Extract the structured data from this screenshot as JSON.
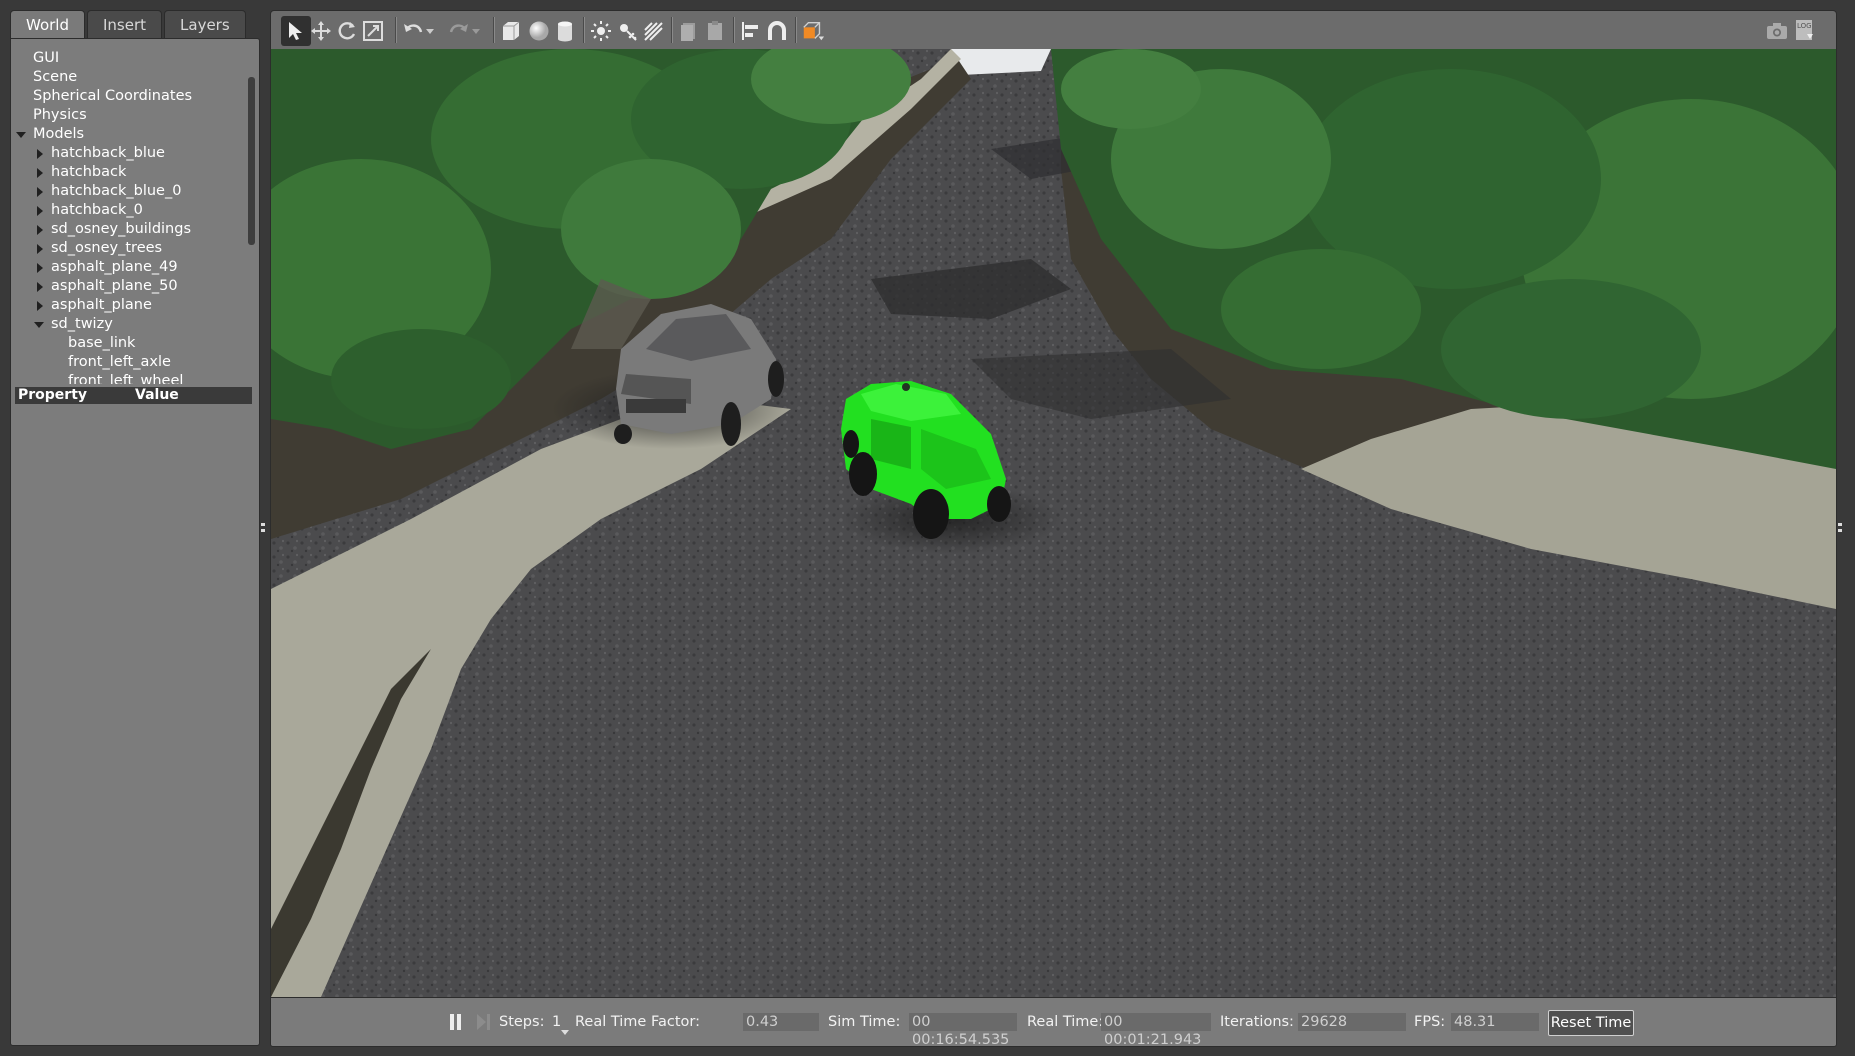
{
  "left_panel": {
    "tabs": [
      {
        "label": "World",
        "active": true
      },
      {
        "label": "Insert",
        "active": false
      },
      {
        "label": "Layers",
        "active": false
      }
    ],
    "tree": [
      {
        "label": "GUI",
        "depth": 0,
        "arrow": "none"
      },
      {
        "label": "Scene",
        "depth": 0,
        "arrow": "none"
      },
      {
        "label": "Spherical Coordinates",
        "depth": 0,
        "arrow": "none"
      },
      {
        "label": "Physics",
        "depth": 0,
        "arrow": "none"
      },
      {
        "label": "Models",
        "depth": 0,
        "arrow": "expanded"
      },
      {
        "label": "hatchback_blue",
        "depth": 1,
        "arrow": "collapsed"
      },
      {
        "label": "hatchback",
        "depth": 1,
        "arrow": "collapsed"
      },
      {
        "label": "hatchback_blue_0",
        "depth": 1,
        "arrow": "collapsed"
      },
      {
        "label": "hatchback_0",
        "depth": 1,
        "arrow": "collapsed"
      },
      {
        "label": "sd_osney_buildings",
        "depth": 1,
        "arrow": "collapsed"
      },
      {
        "label": "sd_osney_trees",
        "depth": 1,
        "arrow": "collapsed"
      },
      {
        "label": "asphalt_plane_49",
        "depth": 1,
        "arrow": "collapsed"
      },
      {
        "label": "asphalt_plane_50",
        "depth": 1,
        "arrow": "collapsed"
      },
      {
        "label": "asphalt_plane",
        "depth": 1,
        "arrow": "collapsed"
      },
      {
        "label": "sd_twizy",
        "depth": 1,
        "arrow": "expanded"
      },
      {
        "label": "base_link",
        "depth": 2,
        "arrow": "none"
      },
      {
        "label": "front_left_axle",
        "depth": 2,
        "arrow": "none"
      },
      {
        "label": "front_left_wheel",
        "depth": 2,
        "arrow": "none"
      }
    ],
    "property_header": {
      "property": "Property",
      "value": "Value"
    }
  },
  "toolbar": {
    "icons": [
      "select-arrow-icon",
      "translate-icon",
      "rotate-icon",
      "scale-icon",
      "undo-icon",
      "undo-dropdown-icon",
      "redo-icon",
      "redo-dropdown-icon",
      "box-shape-icon",
      "sphere-shape-icon",
      "cylinder-shape-icon",
      "point-light-icon",
      "spot-light-icon",
      "directional-light-icon",
      "copy-icon",
      "paste-icon",
      "align-icon",
      "snap-magnet-icon",
      "view-angle-icon",
      "screenshot-icon",
      "log-icon"
    ],
    "accent_color": "#f08a24"
  },
  "bottom_bar": {
    "steps_label": "Steps:",
    "steps_value": "1",
    "rtf_label": "Real Time Factor:",
    "rtf_value": "0.43",
    "sim_time_label": "Sim Time:",
    "sim_time_value": "00 00:16:54.535",
    "real_time_label": "Real Time:",
    "real_time_value": "00 00:01:21.943",
    "iterations_label": "Iterations:",
    "iterations_value": "29628",
    "fps_label": "FPS:",
    "fps_value": "48.31",
    "reset_label": "Reset Time"
  },
  "scene": {
    "colors": {
      "asphalt": "#4b4b4d",
      "sidewalk": "#a9a89a",
      "shadow": "#3f3c32",
      "tree_dark": "#2c5a2c",
      "tree_light": "#3f7a3c",
      "green_car": "#22e020",
      "grey_car": "#7a7a7a"
    }
  }
}
